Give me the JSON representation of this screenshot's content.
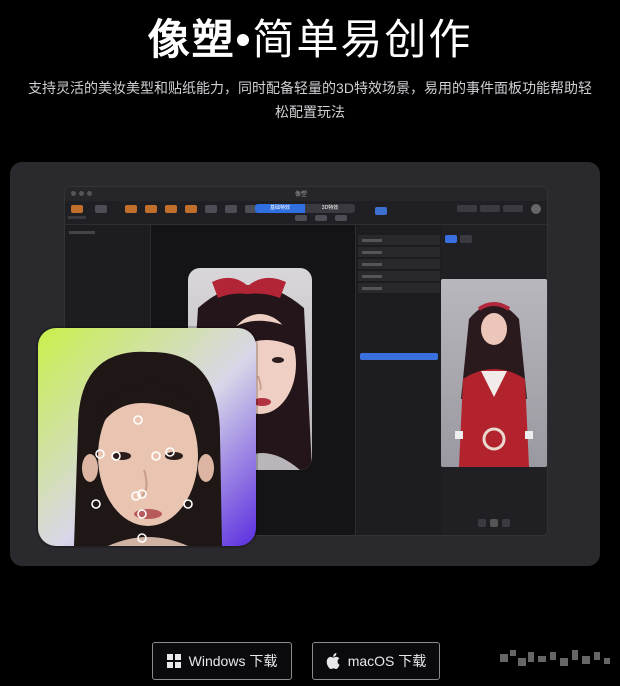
{
  "header": {
    "title_strong": "像塑",
    "title_sep": "•",
    "title_light": "简单易创作",
    "subtitle_line1": "支持灵活的美妆美型和贴纸能力，同时配备轻量的3D特效场景，易用的事件面板功能帮助轻",
    "subtitle_line2": "松配置玩法"
  },
  "app": {
    "window_title": "像塑",
    "segmented": [
      "基础特效",
      "3D特效"
    ],
    "segmented_active": 0
  },
  "downloads": {
    "windows_label": "Windows 下载",
    "mac_label": "macOS 下载"
  },
  "icons": [
    "windows-icon",
    "apple-icon"
  ],
  "colors": {
    "accent": "#2f6fe0",
    "face_gradient_start": "#c8f04a",
    "face_gradient_end": "#5a2de0"
  }
}
